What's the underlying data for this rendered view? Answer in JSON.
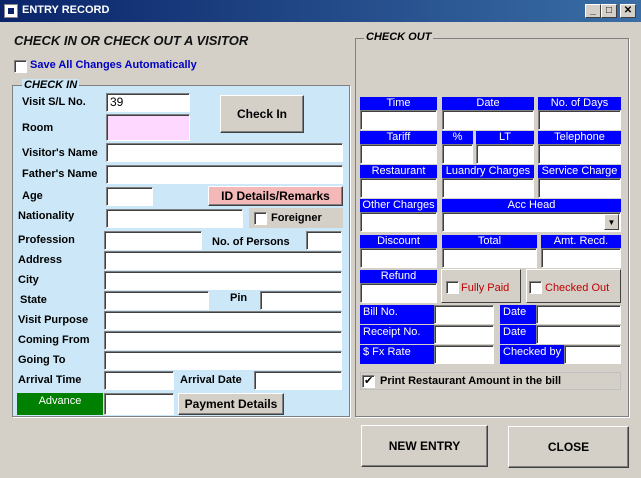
{
  "window": {
    "title": "ENTRY RECORD",
    "minimize": "_",
    "maximize": "□",
    "close": "✕"
  },
  "main_heading": "CHECK IN OR CHECK OUT A VISITOR",
  "save_auto": {
    "label": "Save All Changes Automatically",
    "checked": false
  },
  "checkin": {
    "group_label": "CHECK IN",
    "visit_sl_label": "Visit S/L No.",
    "visit_sl_value": "39",
    "room_label": "Room",
    "room_value": "",
    "check_in_button": "Check In",
    "visitor_name_label": "Visitor's Name",
    "father_name_label": "Father's Name",
    "age_label": "Age",
    "id_details_button": "ID Details/Remarks",
    "nationality_label": "Nationality",
    "foreigner_label": "Foreigner",
    "profession_label": "Profession",
    "no_persons_label": "No. of Persons",
    "address_label": "Address",
    "city_label": "City",
    "state_label": "State",
    "pin_label": "Pin",
    "visit_purpose_label": "Visit Purpose",
    "coming_from_label": "Coming From",
    "going_to_label": "Going To",
    "arrival_time_label": "Arrival Time",
    "arrival_date_label": "Arrival Date",
    "advance_label": "Advance",
    "payment_details_button": "Payment Details"
  },
  "checkout": {
    "group_label": "CHECK OUT",
    "time": "Time",
    "date": "Date",
    "no_days": "No. of Days",
    "tariff": "Tariff",
    "percent": "%",
    "lt": "LT",
    "telephone": "Telephone",
    "restaurant": "Restaurant",
    "laundry": "Luandry Charges",
    "service": "Service Charge",
    "other": "Other Charges",
    "acc_head": "Acc Head",
    "discount": "Discount",
    "total": "Total",
    "amt_recd": "Amt. Recd.",
    "refund": "Refund",
    "fully_paid": "Fully Paid",
    "checked_out": "Checked Out",
    "bill_no": "Bill No.",
    "date2": "Date",
    "receipt_no": "Receipt No.",
    "date3": "Date",
    "fx_rate": "$ Fx Rate",
    "checked_by": "Checked by",
    "print_restaurant": "Print Restaurant Amount in the bill"
  },
  "buttons": {
    "new_entry": "NEW ENTRY",
    "close": "CLOSE"
  },
  "colors": {
    "title_bar": "#0a246a",
    "form_bg": "#d4d0c8",
    "checkin_bg": "#cce8f8",
    "label_blue": "#0000ff",
    "advance_green": "#008000",
    "id_btn": "#f4b8b8",
    "room_pink": "#ffd8ff",
    "red_text": "#c00000"
  }
}
